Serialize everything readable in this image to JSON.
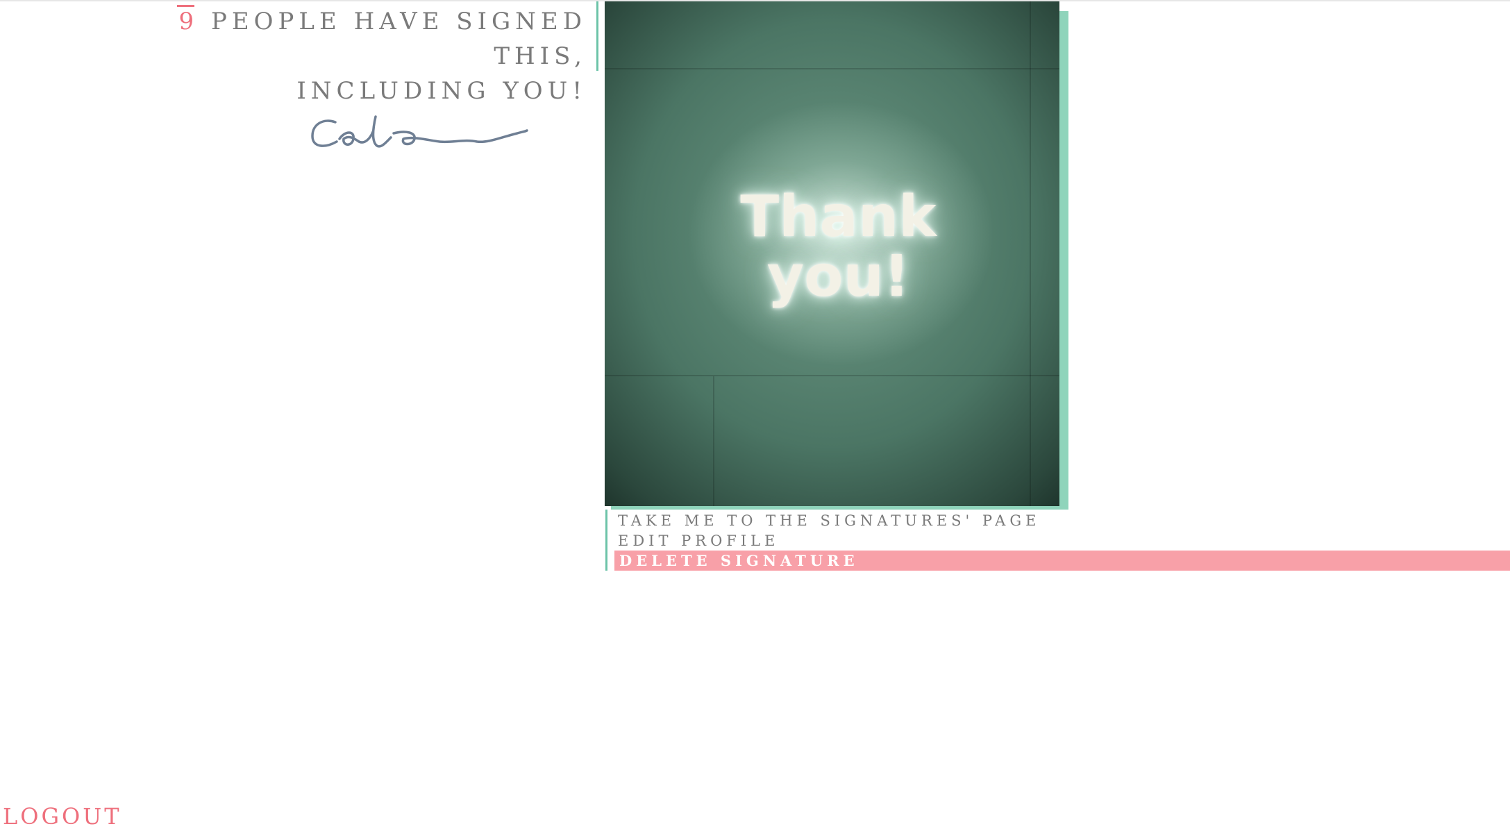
{
  "signers": {
    "count": "9",
    "text_line1": "people have signed this,",
    "text_line2": "including you!"
  },
  "photo": {
    "line1": "Thank",
    "line2": "you!"
  },
  "menu": {
    "signatures_page": "Take me to the signatures' page",
    "edit_profile": "Edit profile",
    "delete_signature": "Delete signature"
  },
  "footer": {
    "logout": "Logout"
  },
  "colors": {
    "accent_pink": "#ee6f7c",
    "delete_bar": "#f8a0a8",
    "accent_green": "#6cc3a8",
    "text_gray": "#7a7a7a"
  }
}
